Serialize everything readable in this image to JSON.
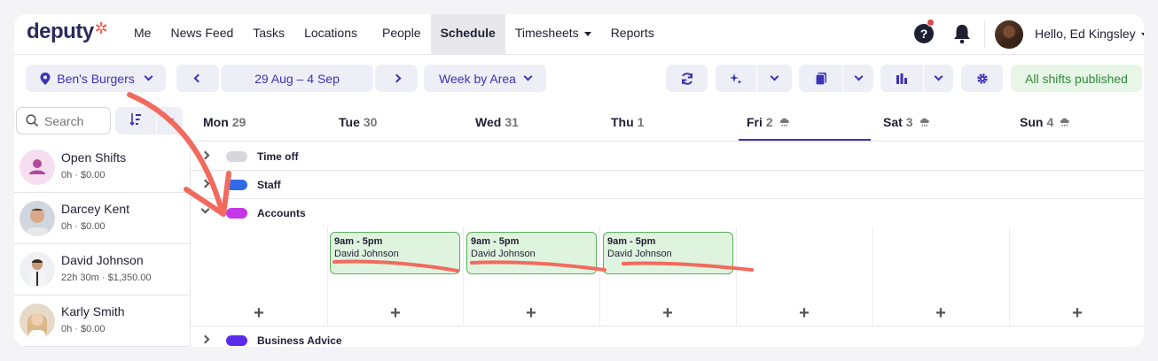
{
  "brand": {
    "logo_text": "deputy"
  },
  "nav": {
    "items": [
      {
        "label": "Me"
      },
      {
        "label": "News Feed"
      },
      {
        "label": "Tasks"
      },
      {
        "label": "Locations"
      },
      {
        "label": "People"
      },
      {
        "label": "Schedule"
      },
      {
        "label": "Timesheets"
      },
      {
        "label": "Reports"
      }
    ],
    "active": "Schedule",
    "help_glyph": "?",
    "user_greeting": "Hello, Ed Kingsley"
  },
  "toolbar": {
    "location": "Ben's Burgers",
    "date_range": "29 Aug – 4 Sep",
    "view": "Week by Area",
    "status": "All shifts published"
  },
  "sidebar": {
    "search_placeholder": "Search",
    "employees": [
      {
        "name": "Open Shifts",
        "summary": "0h · $0.00"
      },
      {
        "name": "Darcey Kent",
        "summary": "0h · $0.00"
      },
      {
        "name": "David Johnson",
        "summary": "22h 30m · $1,350.00"
      },
      {
        "name": "Karly Smith",
        "summary": "0h · $0.00"
      }
    ]
  },
  "calendar": {
    "days": [
      {
        "name": "Mon",
        "num": "29"
      },
      {
        "name": "Tue",
        "num": "30"
      },
      {
        "name": "Wed",
        "num": "31"
      },
      {
        "name": "Thu",
        "num": "1"
      },
      {
        "name": "Fri",
        "num": "2"
      },
      {
        "name": "Sat",
        "num": "3"
      },
      {
        "name": "Sun",
        "num": "4"
      }
    ],
    "selected_day": "Fri",
    "groups": [
      {
        "label": "Time off",
        "color": "#d6d6dc"
      },
      {
        "label": "Staff",
        "color": "#2f6be8"
      },
      {
        "label": "Accounts",
        "color": "#c436e8"
      },
      {
        "label": "Business Advice",
        "color": "#5a2be8"
      }
    ],
    "shifts": [
      {
        "time": "9am - 5pm",
        "person": "David Johnson",
        "day": "Tue"
      },
      {
        "time": "9am - 5pm",
        "person": "David Johnson",
        "day": "Wed"
      },
      {
        "time": "9am - 5pm",
        "person": "David Johnson",
        "day": "Thu"
      }
    ],
    "add_glyph": "+"
  },
  "colors": {
    "accent": "#3b33b8",
    "annotation": "#f26a5e",
    "published_bg": "#e7f6e7",
    "published_text": "#2f8a3a",
    "shift_bg": "#dff4df",
    "shift_border": "#5bae5b"
  }
}
